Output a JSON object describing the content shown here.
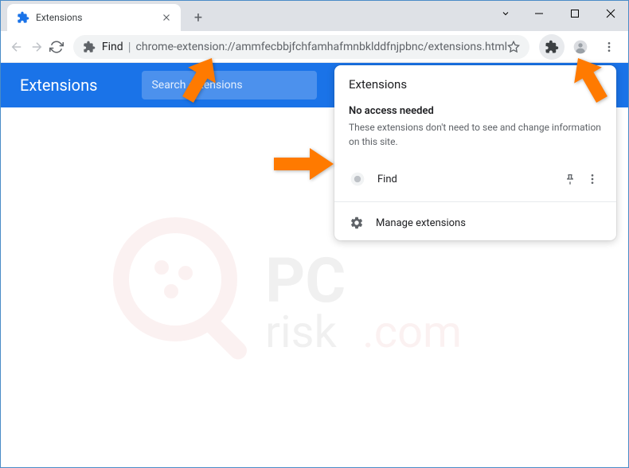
{
  "tab": {
    "title": "Extensions"
  },
  "omnibox": {
    "label": "Find",
    "url": "chrome-extension://ammfecbbjfchfamhafmnbklddfnjpbnc/extensions.html"
  },
  "app": {
    "title": "Extensions",
    "search_placeholder": "Search extensions"
  },
  "popup": {
    "title": "Extensions",
    "section_title": "No access needed",
    "section_desc": "These extensions don't need to see and change information on this site.",
    "ext_name": "Find",
    "manage_label": "Manage extensions"
  },
  "watermark": {
    "text": "PCrisk.com"
  }
}
